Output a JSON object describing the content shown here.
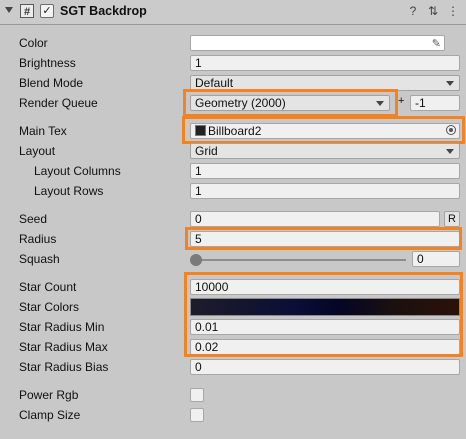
{
  "header": {
    "title": "SGT Backdrop",
    "enabled_glyph": "✓",
    "script_icon_glyph": "#",
    "help_icon": "?",
    "settings_icon": "⇅",
    "menu_icon": "⋮"
  },
  "properties": {
    "color": {
      "label": "Color",
      "value": "#ffffff"
    },
    "brightness": {
      "label": "Brightness",
      "value": "1"
    },
    "blend_mode": {
      "label": "Blend Mode",
      "value": "Default"
    },
    "render_queue": {
      "label": "Render Queue",
      "value": "Geometry (2000)",
      "plus": "+",
      "offset": "-1"
    },
    "main_tex": {
      "label": "Main Tex",
      "value": "Billboard2"
    },
    "layout": {
      "label": "Layout",
      "value": "Grid"
    },
    "layout_columns": {
      "label": "Layout Columns",
      "value": "1"
    },
    "layout_rows": {
      "label": "Layout Rows",
      "value": "1"
    },
    "seed": {
      "label": "Seed",
      "value": "0",
      "randomize_label": "R"
    },
    "radius": {
      "label": "Radius",
      "value": "5"
    },
    "squash": {
      "label": "Squash",
      "value": "0",
      "slider_fraction": 0
    },
    "star_count": {
      "label": "Star Count",
      "value": "10000"
    },
    "star_colors": {
      "label": "Star Colors"
    },
    "star_radius_min": {
      "label": "Star Radius Min",
      "value": "0.01"
    },
    "star_radius_max": {
      "label": "Star Radius Max",
      "value": "0.02"
    },
    "star_radius_bias": {
      "label": "Star Radius Bias",
      "value": "0"
    },
    "power_rgb": {
      "label": "Power Rgb",
      "checked": false
    },
    "clamp_size": {
      "label": "Clamp Size",
      "checked": false
    }
  },
  "colors": {
    "highlight": "#f58220",
    "panel_background": "#c8c8c8"
  }
}
